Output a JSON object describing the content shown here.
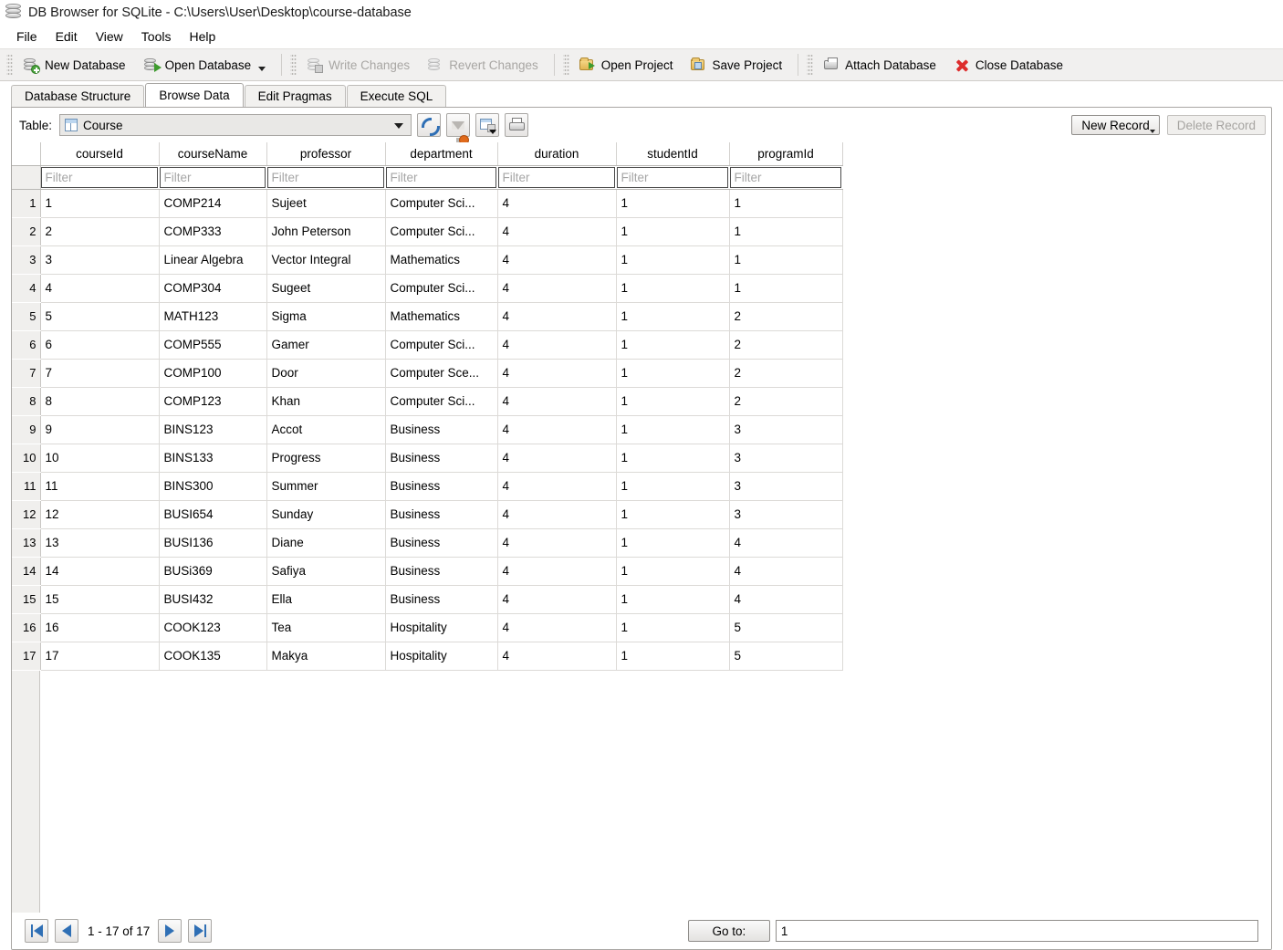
{
  "window": {
    "title": "DB Browser for SQLite - C:\\Users\\User\\Desktop\\course-database",
    "app_icon": "database-icon"
  },
  "menubar": {
    "items": [
      {
        "label": "File"
      },
      {
        "label": "Edit"
      },
      {
        "label": "View"
      },
      {
        "label": "Tools"
      },
      {
        "label": "Help"
      }
    ]
  },
  "toolbar": {
    "buttons": [
      {
        "label": "New Database",
        "icon": "database-new-icon",
        "enabled": true
      },
      {
        "label": "Open Database",
        "icon": "database-open-icon",
        "enabled": true,
        "has_dropdown": true
      },
      {
        "label": "Write Changes",
        "icon": "write-changes-icon",
        "enabled": false
      },
      {
        "label": "Revert Changes",
        "icon": "revert-changes-icon",
        "enabled": false
      },
      {
        "label": "Open Project",
        "icon": "folder-open-icon",
        "enabled": true
      },
      {
        "label": "Save Project",
        "icon": "folder-save-icon",
        "enabled": true
      },
      {
        "label": "Attach Database",
        "icon": "attach-database-icon",
        "enabled": true
      },
      {
        "label": "Close Database",
        "icon": "close-database-icon",
        "enabled": true
      }
    ]
  },
  "tabs": [
    {
      "label": "Database Structure",
      "active": false
    },
    {
      "label": "Browse Data",
      "active": true
    },
    {
      "label": "Edit Pragmas",
      "active": false
    },
    {
      "label": "Execute SQL",
      "active": false
    }
  ],
  "browse": {
    "table_label": "Table:",
    "selected_table": "Course",
    "table_icon": "table-grid-icon",
    "grid_tools": [
      {
        "icon": "refresh-icon",
        "name": "refresh-button"
      },
      {
        "icon": "clear-filters-icon",
        "name": "clear-filters-button"
      },
      {
        "icon": "save-results-icon",
        "name": "save-results-button"
      },
      {
        "icon": "print-icon",
        "name": "print-button"
      }
    ],
    "new_record_label": "New Record",
    "delete_record_label": "Delete Record",
    "delete_record_enabled": false,
    "filter_placeholder": "Filter",
    "columns": [
      "courseId",
      "courseName",
      "professor",
      "department",
      "duration",
      "studentId",
      "programId"
    ],
    "rows": [
      {
        "n": "1",
        "courseId": "1",
        "courseName": "COMP214",
        "professor": "Sujeet",
        "department": "Computer Sci...",
        "duration": "4",
        "studentId": "1",
        "programId": "1"
      },
      {
        "n": "2",
        "courseId": "2",
        "courseName": "COMP333",
        "professor": "John Peterson",
        "department": "Computer Sci...",
        "duration": "4",
        "studentId": "1",
        "programId": "1"
      },
      {
        "n": "3",
        "courseId": "3",
        "courseName": "Linear Algebra",
        "professor": "Vector Integral",
        "department": "Mathematics",
        "duration": "4",
        "studentId": "1",
        "programId": "1"
      },
      {
        "n": "4",
        "courseId": "4",
        "courseName": "COMP304",
        "professor": "Sugeet",
        "department": "Computer Sci...",
        "duration": "4",
        "studentId": "1",
        "programId": "1"
      },
      {
        "n": "5",
        "courseId": "5",
        "courseName": "MATH123",
        "professor": "Sigma",
        "department": "Mathematics",
        "duration": "4",
        "studentId": "1",
        "programId": "2"
      },
      {
        "n": "6",
        "courseId": "6",
        "courseName": "COMP555",
        "professor": "Gamer",
        "department": "Computer Sci...",
        "duration": "4",
        "studentId": "1",
        "programId": "2"
      },
      {
        "n": "7",
        "courseId": "7",
        "courseName": "COMP100",
        "professor": "Door",
        "department": "Computer Sce...",
        "duration": "4",
        "studentId": "1",
        "programId": "2"
      },
      {
        "n": "8",
        "courseId": "8",
        "courseName": "COMP123",
        "professor": "Khan",
        "department": "Computer Sci...",
        "duration": "4",
        "studentId": "1",
        "programId": "2"
      },
      {
        "n": "9",
        "courseId": "9",
        "courseName": "BINS123",
        "professor": "Accot",
        "department": "Business",
        "duration": "4",
        "studentId": "1",
        "programId": "3"
      },
      {
        "n": "10",
        "courseId": "10",
        "courseName": "BINS133",
        "professor": "Progress",
        "department": "Business",
        "duration": "4",
        "studentId": "1",
        "programId": "3"
      },
      {
        "n": "11",
        "courseId": "11",
        "courseName": "BINS300",
        "professor": "Summer",
        "department": "Business",
        "duration": "4",
        "studentId": "1",
        "programId": "3"
      },
      {
        "n": "12",
        "courseId": "12",
        "courseName": "BUSI654",
        "professor": "Sunday",
        "department": "Business",
        "duration": "4",
        "studentId": "1",
        "programId": "3"
      },
      {
        "n": "13",
        "courseId": "13",
        "courseName": "BUSI136",
        "professor": "Diane",
        "department": "Business",
        "duration": "4",
        "studentId": "1",
        "programId": "4"
      },
      {
        "n": "14",
        "courseId": "14",
        "courseName": "BUSi369",
        "professor": "Safiya",
        "department": "Business",
        "duration": "4",
        "studentId": "1",
        "programId": "4"
      },
      {
        "n": "15",
        "courseId": "15",
        "courseName": "BUSI432",
        "professor": "Ella",
        "department": "Business",
        "duration": "4",
        "studentId": "1",
        "programId": "4"
      },
      {
        "n": "16",
        "courseId": "16",
        "courseName": "COOK123",
        "professor": "Tea",
        "department": "Hospitality",
        "duration": "4",
        "studentId": "1",
        "programId": "5"
      },
      {
        "n": "17",
        "courseId": "17",
        "courseName": "COOK135",
        "professor": "Makya",
        "department": "Hospitality",
        "duration": "4",
        "studentId": "1",
        "programId": "5"
      }
    ]
  },
  "pagination": {
    "first_icon": "first-page-icon",
    "prev_icon": "previous-page-icon",
    "next_icon": "next-page-icon",
    "last_icon": "last-page-icon",
    "range_text": "1 - 17 of 17",
    "goto_label": "Go to:",
    "goto_value": "1"
  },
  "colors": {
    "accent_blue": "#2f6fb5",
    "toolbar_bg": "#f1f0ef",
    "gutter_bg": "#f0efed",
    "close_red": "#dd2c2c",
    "green": "#3e9b2e"
  }
}
